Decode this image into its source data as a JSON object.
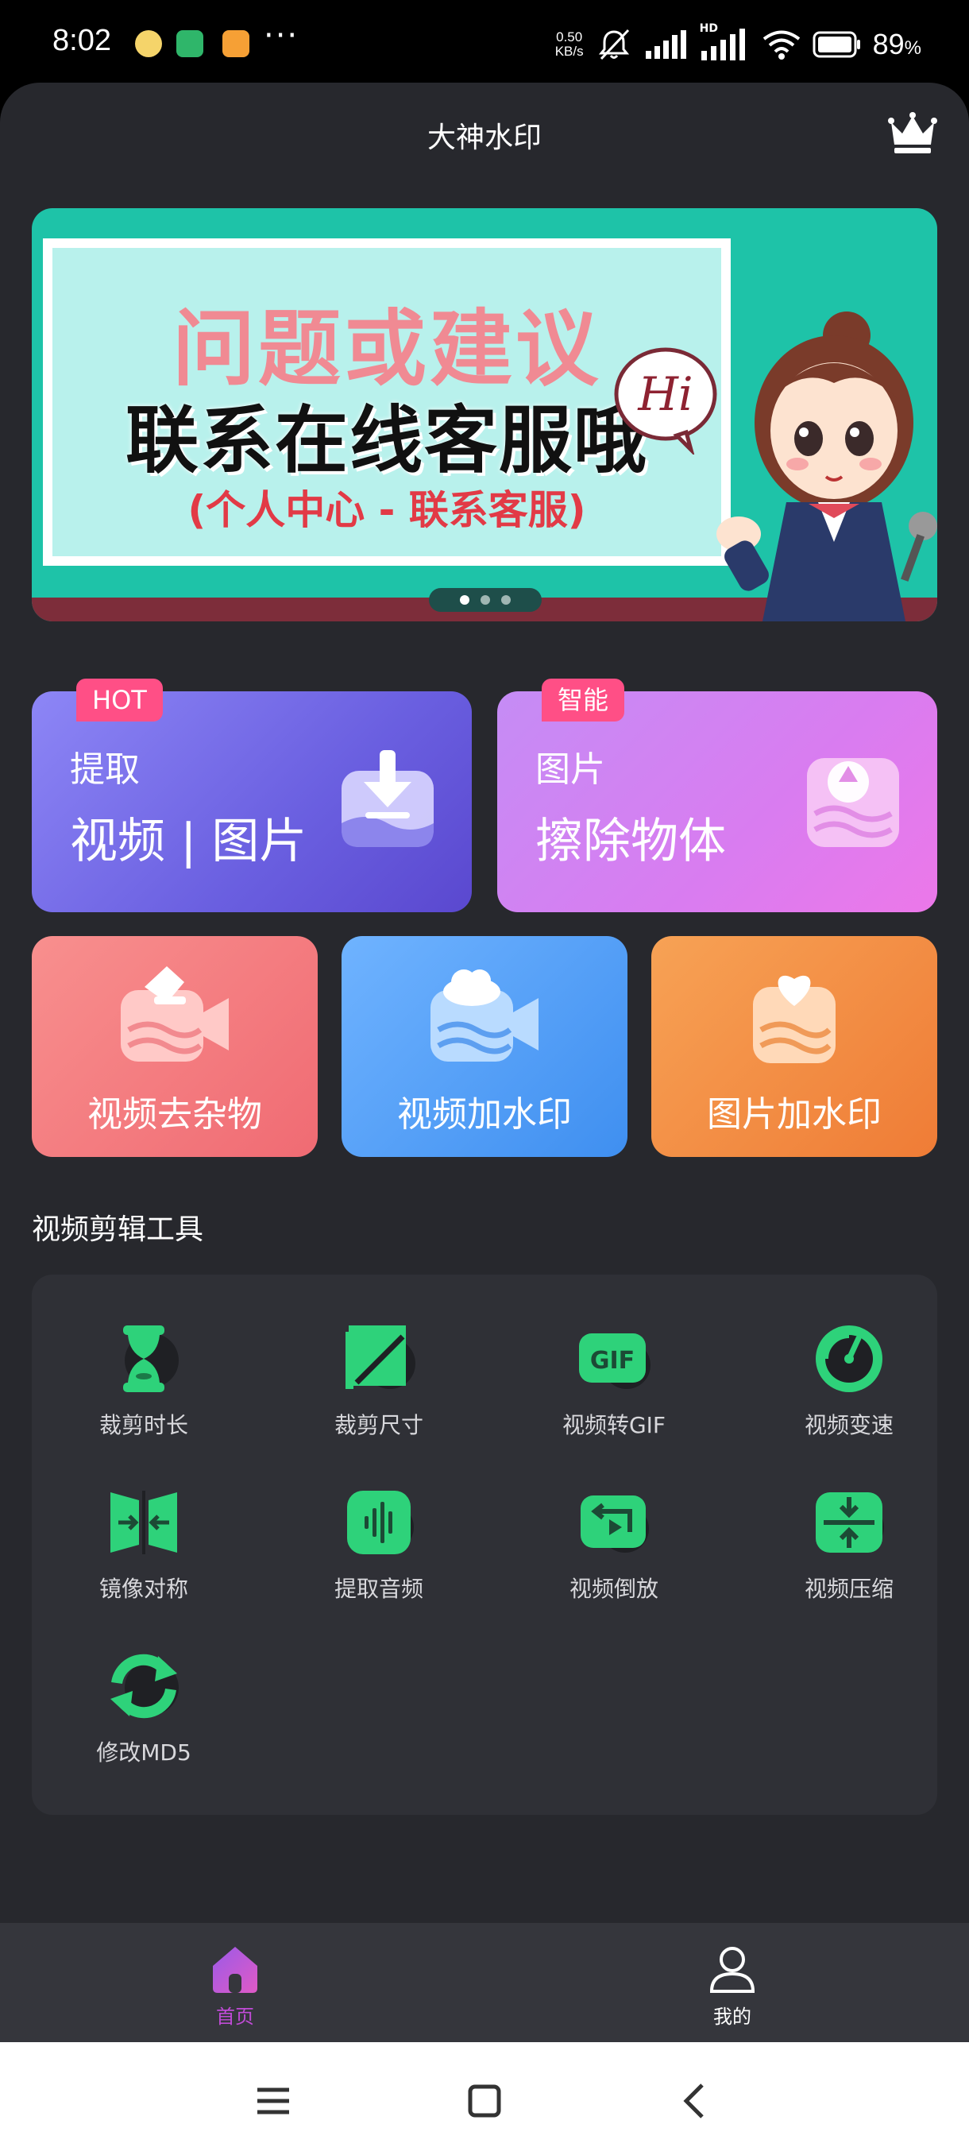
{
  "status_bar": {
    "time": "8:02",
    "net_speed_value": "0.50",
    "net_speed_unit": "KB/s",
    "hd_badge": "HD",
    "battery": "89",
    "battery_unit": "%",
    "more": "···"
  },
  "header": {
    "title": "大神水印"
  },
  "banner": {
    "line1": "问题或建议",
    "line2": "联系在线客服哦",
    "line3": "(个人中心 - 联系客服)",
    "bubble": "Hi",
    "page_count": 3,
    "active_page": 1
  },
  "feature_cards": {
    "extract": {
      "tag": "HOT",
      "line1": "提取",
      "line2": "视频 | 图片"
    },
    "erase": {
      "tag": "智能",
      "line1": "图片",
      "line2": "擦除物体"
    },
    "video_clean": {
      "label": "视频去杂物"
    },
    "video_watermark": {
      "label": "视频加水印"
    },
    "image_watermark": {
      "label": "图片加水印"
    }
  },
  "tools": {
    "title": "视频剪辑工具",
    "items": [
      {
        "label": "裁剪时长",
        "icon": "hourglass-icon"
      },
      {
        "label": "裁剪尺寸",
        "icon": "crop-icon"
      },
      {
        "label": "视频转GIF",
        "icon": "gif-icon",
        "badge": "GIF"
      },
      {
        "label": "视频变速",
        "icon": "speedometer-icon"
      },
      {
        "label": "镜像对称",
        "icon": "mirror-icon"
      },
      {
        "label": "提取音频",
        "icon": "audio-wave-icon"
      },
      {
        "label": "视频倒放",
        "icon": "reverse-play-icon"
      },
      {
        "label": "视频压缩",
        "icon": "compress-icon"
      },
      {
        "label": "修改MD5",
        "icon": "refresh-icon"
      }
    ]
  },
  "bottom_nav": {
    "home": "首页",
    "mine": "我的",
    "active_color": "#c04bd6",
    "inactive_color": "#ffffff"
  },
  "colors": {
    "app_bg": "#27282d",
    "tool_green": "#2ed27a",
    "tag_pink": "#ff4f86"
  }
}
